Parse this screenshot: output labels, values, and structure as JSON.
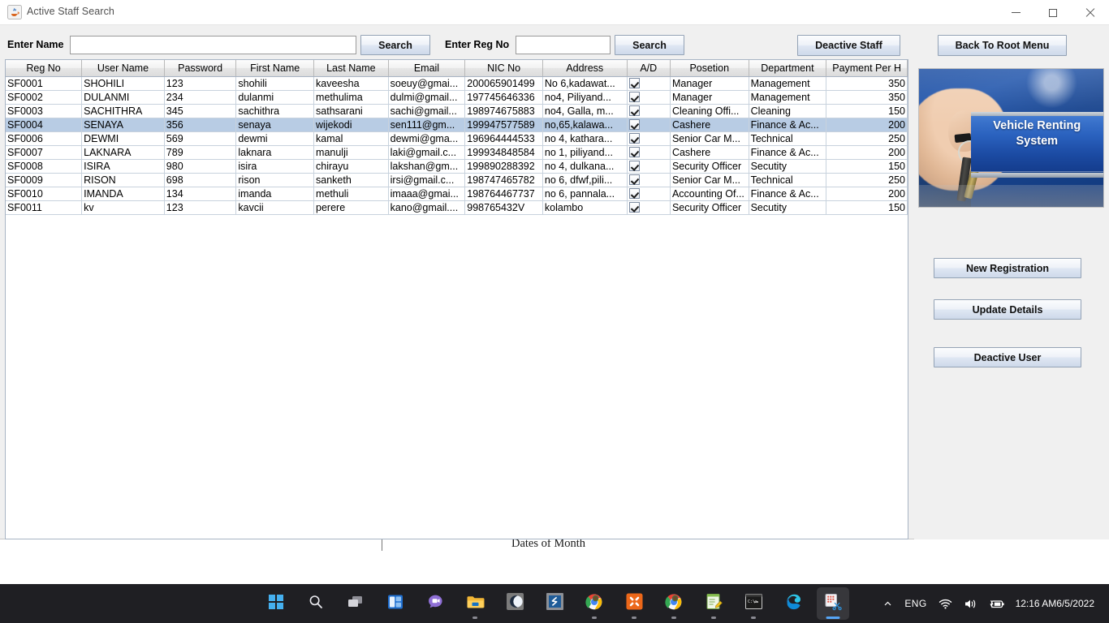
{
  "window": {
    "title": "Active Staff Search",
    "icon": "java-coffee-cup-icon",
    "controls": {
      "minimize": "minimize",
      "maximize": "maximize",
      "close": "close"
    }
  },
  "toolbar": {
    "name_label": "Enter Name",
    "name_value": "",
    "name_placeholder": "",
    "search_name_label": "Search",
    "regno_label": "Enter Reg No",
    "regno_value": "",
    "regno_placeholder": "",
    "search_regno_label": "Search",
    "deactive_staff_label": "Deactive Staff",
    "back_to_root_label": "Back To Root Menu"
  },
  "table": {
    "columns": [
      "Reg No",
      "User Name",
      "Password",
      "First Name",
      "Last Name",
      "Email",
      "NIC No",
      "Address",
      "A/D",
      "Posetion",
      "Department",
      "Payment Per H"
    ],
    "selected_row_index": 3,
    "selection_color": "#b8cce4",
    "rows": [
      {
        "reg_no": "SF0001",
        "user_name": "SHOHILI",
        "password": "123",
        "first_name": "shohili",
        "last_name": "kaveesha",
        "email": "soeuy@gmai...",
        "nic_no": "200065901499",
        "address": "No 6,kadawat...",
        "ad": true,
        "posetion": "Manager",
        "department": "Management",
        "payment_per_h": "350"
      },
      {
        "reg_no": "SF0002",
        "user_name": "DULANMI",
        "password": "234",
        "first_name": "dulanmi",
        "last_name": "methulima",
        "email": "dulmi@gmail...",
        "nic_no": "197745646336",
        "address": "no4, Piliyand...",
        "ad": true,
        "posetion": "Manager",
        "department": "Management",
        "payment_per_h": "350"
      },
      {
        "reg_no": "SF0003",
        "user_name": "SACHITHRA",
        "password": "345",
        "first_name": "sachithra",
        "last_name": "sathsarani",
        "email": "sachi@gmail...",
        "nic_no": "198974675883",
        "address": "no4, Galla, m...",
        "ad": true,
        "posetion": "Cleaning Offi...",
        "department": "Cleaning",
        "payment_per_h": "150"
      },
      {
        "reg_no": "SF0004",
        "user_name": "SENAYA",
        "password": "356",
        "first_name": "senaya",
        "last_name": "wijekodi",
        "email": "sen111@gm...",
        "nic_no": "199947577589",
        "address": "no,65,kalawa...",
        "ad": true,
        "posetion": "Cashere",
        "department": "Finance & Ac...",
        "payment_per_h": "200"
      },
      {
        "reg_no": "SF0006",
        "user_name": "DEWMI",
        "password": "569",
        "first_name": "dewmi",
        "last_name": "kamal",
        "email": "dewmi@gma...",
        "nic_no": "196964444533",
        "address": "no 4, kathara...",
        "ad": true,
        "posetion": "Senior Car M...",
        "department": "Technical",
        "payment_per_h": "250"
      },
      {
        "reg_no": "SF0007",
        "user_name": "LAKNARA",
        "password": "789",
        "first_name": "laknara",
        "last_name": "manulji",
        "email": "laki@gmail.c...",
        "nic_no": "199934848584",
        "address": "no 1, piliyand...",
        "ad": true,
        "posetion": "Cashere",
        "department": "Finance & Ac...",
        "payment_per_h": "200"
      },
      {
        "reg_no": "SF0008",
        "user_name": "ISIRA",
        "password": "980",
        "first_name": "isira",
        "last_name": "chirayu",
        "email": "lakshan@gm...",
        "nic_no": "199890288392",
        "address": "no 4, dulkana...",
        "ad": true,
        "posetion": "Security Officer",
        "department": "Secutity",
        "payment_per_h": "150"
      },
      {
        "reg_no": "SF0009",
        "user_name": "RISON",
        "password": "698",
        "first_name": "rison",
        "last_name": "sanketh",
        "email": "irsi@gmail.c...",
        "nic_no": "198747465782",
        "address": "no 6, dfwf,pili...",
        "ad": true,
        "posetion": "Senior Car M...",
        "department": "Technical",
        "payment_per_h": "250"
      },
      {
        "reg_no": "SF0010",
        "user_name": "IMANDA",
        "password": "134",
        "first_name": "imanda",
        "last_name": "methuli",
        "email": "imaaa@gmai...",
        "nic_no": "198764467737",
        "address": "no 6, pannala...",
        "ad": true,
        "posetion": "Accounting Of...",
        "department": "Finance & Ac...",
        "payment_per_h": "200"
      },
      {
        "reg_no": "SF0011",
        "user_name": "kv",
        "password": "123",
        "first_name": "kavcii",
        "last_name": "perere",
        "email": "kano@gmail....",
        "nic_no": "998765432V",
        "address": "kolambo",
        "ad": true,
        "posetion": "Security Officer",
        "department": "Secutity",
        "payment_per_h": "150"
      }
    ]
  },
  "side_panel": {
    "banner_title": "Vehicle Renting System",
    "banner_image": "hand-holding-car-keys-photo",
    "new_registration_label": "New Registration",
    "update_details_label": "Update Details",
    "deactive_user_label": "Deactive User"
  },
  "background_page": {
    "text": "Dates of Month"
  },
  "taskbar": {
    "apps": [
      {
        "name": "start-button",
        "icon": "windows-logo-icon",
        "running": false
      },
      {
        "name": "search-button",
        "icon": "search-icon",
        "running": false
      },
      {
        "name": "task-view-button",
        "icon": "task-view-icon",
        "running": false
      },
      {
        "name": "widgets-button",
        "icon": "widgets-icon",
        "running": false
      },
      {
        "name": "chat-button",
        "icon": "chat-video-icon",
        "running": false
      },
      {
        "name": "file-explorer",
        "icon": "folder-icon",
        "running": true
      },
      {
        "name": "app-moon",
        "icon": "moon-icon",
        "running": false
      },
      {
        "name": "app-sublime",
        "icon": "sublime-icon",
        "running": false
      },
      {
        "name": "chrome-window-1",
        "icon": "chrome-icon",
        "running": true
      },
      {
        "name": "xampp",
        "icon": "xampp-icon",
        "running": true
      },
      {
        "name": "chrome-window-2",
        "icon": "chrome-icon",
        "running": true
      },
      {
        "name": "notepad-editor",
        "icon": "notepad-edit-icon",
        "running": true
      },
      {
        "name": "command-prompt",
        "icon": "terminal-icon",
        "running": true
      },
      {
        "name": "edge-browser",
        "icon": "edge-icon",
        "running": false
      },
      {
        "name": "snipping-tool",
        "icon": "snipping-tool-icon",
        "running": true
      }
    ],
    "tray": {
      "overflow_icon": "chevron-up-icon",
      "language": "ENG",
      "wifi_icon": "wifi-icon",
      "volume_icon": "speaker-icon",
      "battery_icon": "battery-charging-icon",
      "time": "12:16 AM",
      "date": "6/5/2022"
    }
  }
}
